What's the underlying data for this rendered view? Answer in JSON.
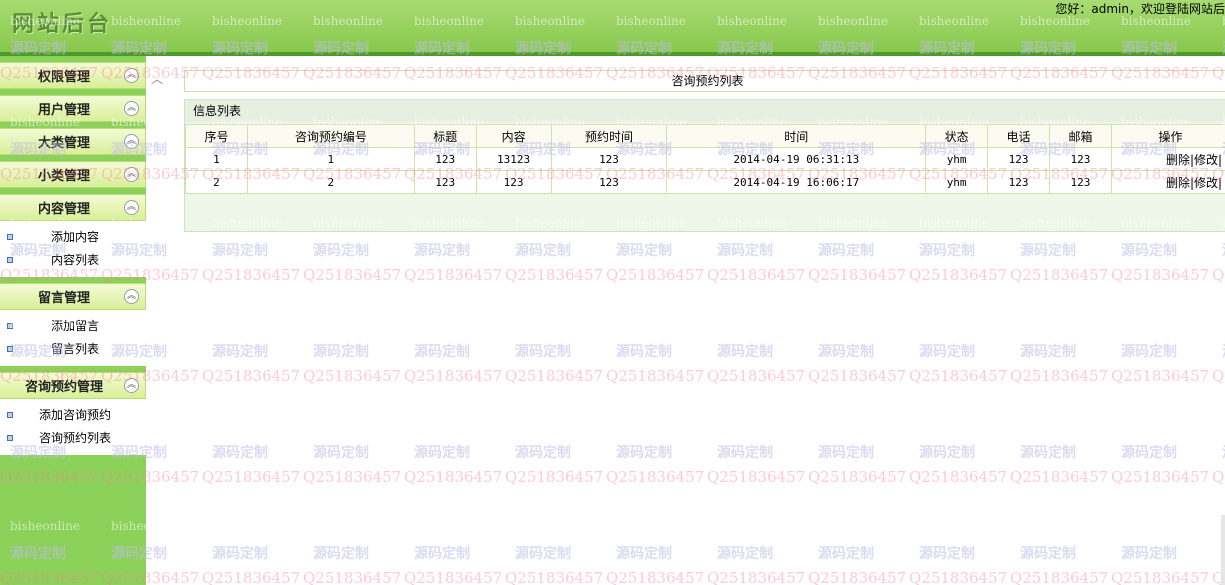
{
  "header": {
    "logo": "网站后台",
    "welcome": "您好：admin，欢迎登陆网站后"
  },
  "sidebar": {
    "menus": [
      {
        "title": "权限管理",
        "items": []
      },
      {
        "title": "用户管理",
        "items": []
      },
      {
        "title": "大类管理",
        "items": []
      },
      {
        "title": "小类管理",
        "items": []
      },
      {
        "title": "内容管理",
        "items": [
          "添加内容",
          "内容列表"
        ]
      },
      {
        "title": "留言管理",
        "items": [
          "添加留言",
          "留言列表"
        ]
      },
      {
        "title": "咨询预约管理",
        "items": [
          "添加咨询预约",
          "咨询预约列表"
        ]
      }
    ],
    "toggle_icon": "double-chevron-up-icon"
  },
  "content": {
    "page_title": "咨询预约列表",
    "panel_title": "信息列表",
    "columns": [
      "序号",
      "咨询预约编号",
      "标题",
      "内容",
      "预约时间",
      "时间",
      "状态",
      "电话",
      "邮箱",
      "操作"
    ],
    "rows": [
      [
        "1",
        "1",
        "123",
        "13123",
        "123",
        "2014-04-19 06:31:13",
        "yhm",
        "123",
        "123",
        "删除|修改|"
      ],
      [
        "2",
        "2",
        "123",
        "123",
        "123",
        "2014-04-19 16:06:17",
        "yhm",
        "123",
        "123",
        "删除|修改|"
      ]
    ]
  },
  "watermark": {
    "line1": "bisheonline",
    "line2": "源码定制",
    "line3": "Q251836457"
  },
  "colors": {
    "header": "#a8dc72",
    "sidebar": "#8cd25a",
    "table_border": "#cfe2a8"
  }
}
